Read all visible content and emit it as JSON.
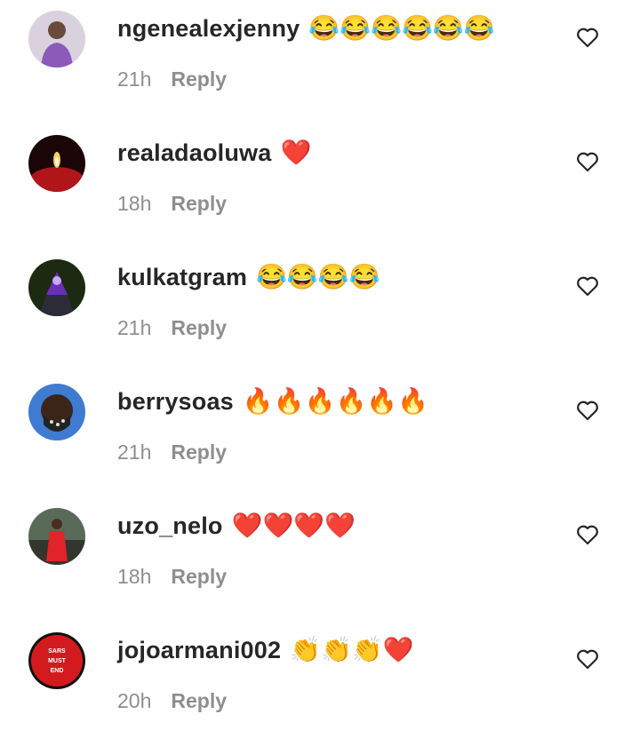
{
  "comments": [
    {
      "username": "ngenealexjenny",
      "text": "😂😂😂😂😂😂",
      "time": "21h",
      "reply_label": "Reply",
      "avatar_icon": "woman-photo"
    },
    {
      "username": "realadaoluwa",
      "text": "❤️",
      "time": "18h",
      "reply_label": "Reply",
      "avatar_icon": "candle-photo"
    },
    {
      "username": "kulkatgram",
      "text": "😂😂😂😂",
      "time": "21h",
      "reply_label": "Reply",
      "avatar_icon": "purple-tunnel-photo"
    },
    {
      "username": "berrysoas",
      "text": "🔥🔥🔥🔥🔥🔥",
      "time": "21h",
      "reply_label": "Reply",
      "avatar_icon": "masked-man-photo"
    },
    {
      "username": "uzo_nelo",
      "text": "❤️❤️❤️❤️",
      "time": "18h",
      "reply_label": "Reply",
      "avatar_icon": "woman-red-dress-photo"
    },
    {
      "username": "jojoarmani002",
      "text": "👏👏👏❤️",
      "time": "20h",
      "reply_label": "Reply",
      "avatar_icon": "sars-badge",
      "avatar_text": "SARS MUST END"
    }
  ],
  "colors": {
    "text": "#262626",
    "meta": "#8e8e8e",
    "background": "#ffffff"
  },
  "like_icon": "heart-outline-icon"
}
